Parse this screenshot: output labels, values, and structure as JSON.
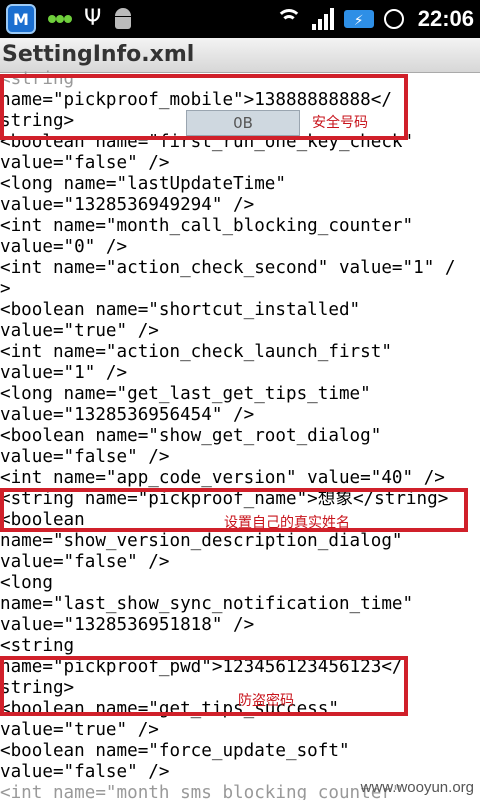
{
  "status_bar": {
    "time": "22:06",
    "battery_icon": "charging-battery-icon"
  },
  "window": {
    "title": "SettingInfo.xml"
  },
  "xml_lines": [
    "<string",
    "name=\"pickproof_mobile\">13888888888</",
    "string>",
    "<boolean name=\"first_run_one_key_check\"",
    "value=\"false\" />",
    "<long name=\"lastUpdateTime\"",
    "value=\"1328536949294\" />",
    "<int name=\"month_call_blocking_counter\"",
    "value=\"0\" />",
    "<int name=\"action_check_second\" value=\"1\" /",
    ">",
    "<boolean name=\"shortcut_installed\"",
    "value=\"true\" />",
    "<int name=\"action_check_launch_first\"",
    "value=\"1\" />",
    "<long name=\"get_last_get_tips_time\"",
    "value=\"1328536956454\" />",
    "<boolean name=\"show_get_root_dialog\"",
    "value=\"false\" />",
    "<int name=\"app_code_version\" value=\"40\" />",
    "<string name=\"pickproof_name\">想象</string>",
    "<boolean",
    "name=\"show_version_description_dialog\"",
    "value=\"false\" />",
    "<long",
    "name=\"last_show_sync_notification_time\"",
    "value=\"1328536951818\" />",
    "<string",
    "name=\"pickproof_pwd\">123456123456123</",
    "string>",
    "<boolean name=\"get_tips_success\"",
    "value=\"true\" />",
    "<boolean name=\"force_update_soft\"",
    "value=\"false\" />",
    "<int name=\"month_sms_blocking_counter\""
  ],
  "annotations": {
    "mobile": "安全号码",
    "name": "设置自己的真实姓名",
    "pwd": "防盗密码"
  },
  "toast": {
    "text": "0B"
  },
  "watermark": "www.wooyun.org",
  "colors": {
    "highlight": "#d0202a",
    "note": "#c8141c"
  }
}
